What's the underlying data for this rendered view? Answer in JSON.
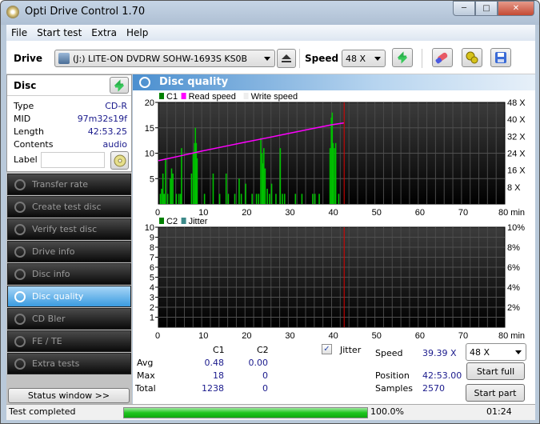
{
  "window": {
    "title": "Opti Drive Control 1.70"
  },
  "menu": [
    "File",
    "Start test",
    "Extra",
    "Help"
  ],
  "toolbar": {
    "drive_label": "Drive",
    "drive_value": "(J:)  LITE-ON DVDRW SOHW-1693S KS0B",
    "speed_label": "Speed",
    "speed_value": "48 X"
  },
  "disc": {
    "title": "Disc",
    "rows": [
      {
        "label": "Type",
        "value": "CD-R"
      },
      {
        "label": "MID",
        "value": "97m32s19f"
      },
      {
        "label": "Length",
        "value": "42:53.25"
      },
      {
        "label": "Contents",
        "value": "audio"
      }
    ],
    "label_field_label": "Label",
    "label_field_value": ""
  },
  "nav": [
    {
      "label": "Transfer rate",
      "active": false
    },
    {
      "label": "Create test disc",
      "active": false
    },
    {
      "label": "Verify test disc",
      "active": false
    },
    {
      "label": "Drive info",
      "active": false
    },
    {
      "label": "Disc info",
      "active": false
    },
    {
      "label": "Disc quality",
      "active": true
    },
    {
      "label": "CD Bler",
      "active": false
    },
    {
      "label": "FE / TE",
      "active": false
    },
    {
      "label": "Extra tests",
      "active": false
    }
  ],
  "status_window_button": "Status window >>",
  "panel_title": "Disc quality",
  "chart_data": [
    {
      "type": "bar",
      "title": "C1 / Read speed",
      "legend": [
        "C1",
        "Read speed",
        "Write speed"
      ],
      "legend_colors": [
        "#008000",
        "#ff00ff",
        "#eeeeee"
      ],
      "xlabel": "min",
      "xlim": [
        0,
        80
      ],
      "x_ticks": [
        "0",
        "10",
        "20",
        "30",
        "40",
        "50",
        "60",
        "70",
        "80 min"
      ],
      "ylim": [
        0,
        20
      ],
      "y_ticks": [
        "5",
        "10",
        "15",
        "20"
      ],
      "y2lim": [
        0,
        48
      ],
      "y2_ticks": [
        "8 X",
        "16 X",
        "24 X",
        "32 X",
        "40 X",
        "48 X"
      ],
      "c1_bars": [
        [
          0.3,
          2
        ],
        [
          0.6,
          3
        ],
        [
          0.9,
          6
        ],
        [
          1.2,
          2
        ],
        [
          1.5,
          9
        ],
        [
          2.0,
          2
        ],
        [
          2.6,
          5
        ],
        [
          2.9,
          7
        ],
        [
          3.2,
          6
        ],
        [
          4.0,
          2
        ],
        [
          4.6,
          2
        ],
        [
          5.2,
          11
        ],
        [
          5.0,
          2
        ],
        [
          7.5,
          6
        ],
        [
          7.9,
          10
        ],
        [
          8.2,
          12
        ],
        [
          8.4,
          15
        ],
        [
          8.6,
          12
        ],
        [
          8.8,
          9
        ],
        [
          10.5,
          2
        ],
        [
          12.5,
          6
        ],
        [
          14.0,
          2
        ],
        [
          15.5,
          6
        ],
        [
          16.0,
          2
        ],
        [
          17.5,
          2
        ],
        [
          18.5,
          5
        ],
        [
          19.0,
          2
        ],
        [
          20.0,
          4
        ],
        [
          21.5,
          2
        ],
        [
          22.5,
          2
        ],
        [
          23.0,
          2
        ],
        [
          23.5,
          13
        ],
        [
          23.8,
          10
        ],
        [
          24.0,
          8
        ],
        [
          24.2,
          11
        ],
        [
          24.5,
          7
        ],
        [
          25.0,
          3
        ],
        [
          25.5,
          2
        ],
        [
          26.0,
          4
        ],
        [
          27.0,
          2
        ],
        [
          28.0,
          11
        ],
        [
          28.5,
          2
        ],
        [
          29.0,
          2
        ],
        [
          31.5,
          2
        ],
        [
          33.0,
          2
        ],
        [
          35.5,
          2
        ],
        [
          36.0,
          2
        ],
        [
          37.0,
          2
        ],
        [
          39.5,
          11
        ],
        [
          39.8,
          17
        ],
        [
          40.0,
          18
        ],
        [
          40.2,
          12
        ],
        [
          40.5,
          11
        ],
        [
          40.8,
          12
        ],
        [
          41.5,
          2
        ]
      ],
      "read_speed_x": [
        0,
        0.3,
        5,
        10,
        15,
        20,
        25,
        30,
        35,
        40,
        42.9
      ],
      "read_speed_y": [
        20.5,
        20.6,
        22.7,
        25.0,
        27.1,
        29.2,
        31.2,
        33.3,
        35.4,
        37.4,
        38.3
      ],
      "marker_x": 42.9
    },
    {
      "type": "bar",
      "title": "C2 / Jitter",
      "legend": [
        "C2",
        "Jitter"
      ],
      "legend_colors": [
        "#008000",
        "#3d8a8a"
      ],
      "xlabel": "min",
      "xlim": [
        0,
        80
      ],
      "x_ticks": [
        "0",
        "10",
        "20",
        "30",
        "40",
        "50",
        "60",
        "70",
        "80 min"
      ],
      "ylim": [
        0,
        10
      ],
      "y_ticks": [
        "1",
        "2",
        "3",
        "4",
        "5",
        "6",
        "7",
        "8",
        "9",
        "10"
      ],
      "y2lim": [
        0,
        10
      ],
      "y2_ticks": [
        "2%",
        "4%",
        "6%",
        "8%",
        "10%"
      ],
      "c2_bars": [],
      "marker_x": 42.9
    }
  ],
  "stats": {
    "headers": [
      "C1",
      "C2"
    ],
    "rows": [
      {
        "label": "Avg",
        "c1": "0.48",
        "c2": "0.00"
      },
      {
        "label": "Max",
        "c1": "18",
        "c2": "0"
      },
      {
        "label": "Total",
        "c1": "1238",
        "c2": "0"
      }
    ],
    "jitter_label": "Jitter",
    "jitter_checked": true
  },
  "info": {
    "speed_label": "Speed",
    "speed_value": "39.39 X",
    "position_label": "Position",
    "position_value": "42:53.00",
    "samples_label": "Samples",
    "samples_value": "2570",
    "speed_select": "48 X",
    "start_full": "Start full",
    "start_part": "Start part"
  },
  "statusbar": {
    "text": "Test completed",
    "progress": 100.0,
    "progress_text": "100.0%",
    "time": "01:24"
  }
}
